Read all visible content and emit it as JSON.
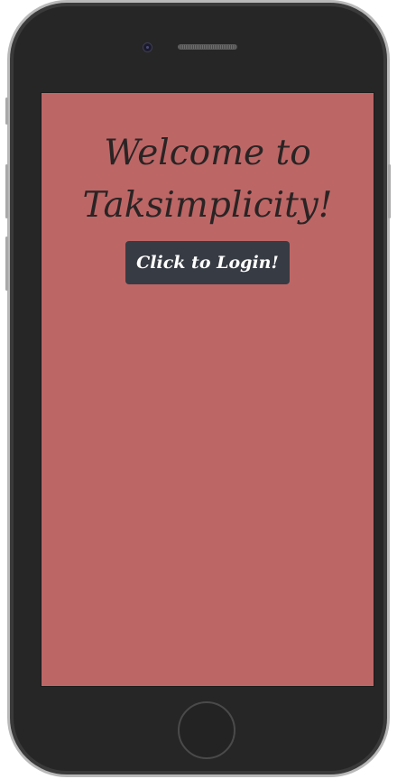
{
  "screen": {
    "welcome_text": "Welcome to Taksimplicity!",
    "login_button_label": "Click to Login!"
  },
  "colors": {
    "screen_background": "#bd6666",
    "button_background": "#373b43",
    "button_text": "#ffffff",
    "heading_text": "#2a2424",
    "device_body": "#262626"
  },
  "icons": [
    "front-camera-icon",
    "speaker-grille-icon",
    "home-button-icon"
  ]
}
